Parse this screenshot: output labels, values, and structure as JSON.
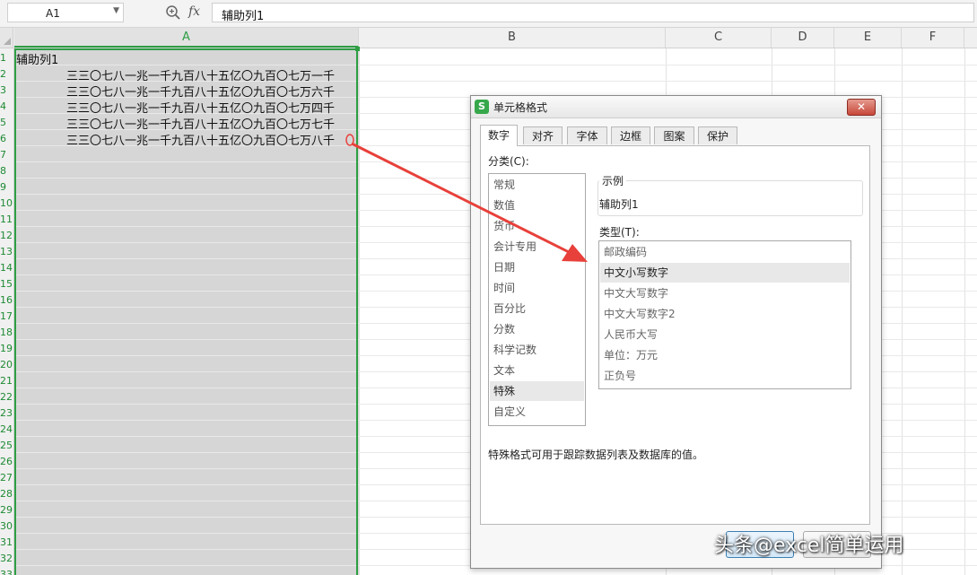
{
  "formula_bar": {
    "name_box": "A1",
    "zoom_icon": "zoom-icon",
    "fx_label": "fx",
    "formula_value": "辅助列1"
  },
  "grid": {
    "columns": [
      "A",
      "B",
      "C",
      "D",
      "E",
      "F"
    ],
    "rows": [
      "1",
      "2",
      "3",
      "4",
      "5",
      "6",
      "7",
      "8",
      "9",
      "10",
      "11",
      "12",
      "13",
      "14",
      "15",
      "16",
      "17",
      "18",
      "19",
      "20",
      "21",
      "22",
      "23",
      "24",
      "25",
      "26",
      "27",
      "28",
      "29",
      "30",
      "31",
      "32",
      "33"
    ],
    "cells": {
      "A1": "辅助列1",
      "A2": "三三〇七八一兆一千九百八十五亿〇九百〇七万一千",
      "A3": "三三〇七八一兆一千九百八十五亿〇九百〇七万六千",
      "A4": "三三〇七八一兆一千九百八十五亿〇九百〇七万四千",
      "A5": "三三〇七八一兆一千九百八十五亿〇九百〇七万七千",
      "A6": "三三〇七八一兆一千九百八十五亿〇九百〇七万八千"
    }
  },
  "dialog": {
    "title": "单元格格式",
    "app_icon": "S",
    "close": "✕",
    "tabs": [
      "数字",
      "对齐",
      "字体",
      "边框",
      "图案",
      "保护"
    ],
    "active_tab": "数字",
    "category_label": "分类(C):",
    "categories": [
      "常规",
      "数值",
      "货币",
      "会计专用",
      "日期",
      "时间",
      "百分比",
      "分数",
      "科学记数",
      "文本",
      "特殊",
      "自定义"
    ],
    "selected_category": "特殊",
    "sample_label": "示例",
    "sample_value": "辅助列1",
    "type_label": "类型(T):",
    "types": [
      "邮政编码",
      "中文小写数字",
      "中文大写数字",
      "中文大写数字2",
      "人民币大写",
      "单位：万元",
      "正负号"
    ],
    "selected_type": "中文小写数字",
    "description": "特殊格式可用于跟踪数据列表及数据库的值。"
  },
  "watermark": "头条@excel简单运用",
  "colors": {
    "selection_border": "#2e9e44",
    "annotation_arrow": "#e8403a",
    "selected_column_fill": "#d6d6d6"
  }
}
